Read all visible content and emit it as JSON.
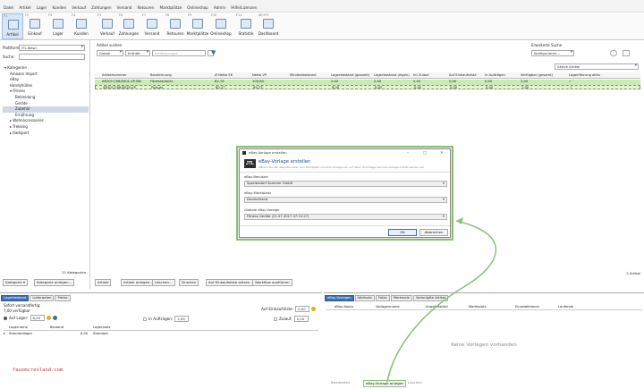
{
  "menu": [
    "Datei",
    "Artikel",
    "Lager",
    "Kunden",
    "Verkauf",
    "Zahlungen",
    "Versand",
    "Retouren",
    "Marktplätze",
    "Onlineshop",
    "Admin",
    "Hilfe/Lizenzen"
  ],
  "toolbar": [
    {
      "key": "F1",
      "label": "Artikel",
      "active": true
    },
    {
      "key": "F2",
      "label": "Einkauf"
    },
    {
      "key": "F3",
      "label": "Lager"
    },
    {
      "key": "F4",
      "label": "Kunden"
    },
    {
      "key": "F5",
      "label": "Verkauf"
    },
    {
      "key": "F6",
      "label": "Zahlungen"
    },
    {
      "key": "F7",
      "label": "Versand"
    },
    {
      "key": "F8",
      "label": "Retouren"
    },
    {
      "key": "F9",
      "label": "Marktplätze"
    },
    {
      "key": "F10",
      "label": "Onlineshop"
    },
    {
      "key": "F11",
      "label": "Statistik"
    },
    {
      "key": "Alt+F2",
      "label": "Dashboard"
    }
  ],
  "sidebar": {
    "plattform_label": "Plattform:",
    "plattform_value": "JTL-Wawi",
    "suche_label": "Suche:",
    "tree": [
      {
        "label": "Kategorien",
        "level": 0
      },
      {
        "label": "Amazon Import",
        "level": 1
      },
      {
        "label": "eBay",
        "level": 1
      },
      {
        "label": "Handyhüllen",
        "level": 1
      },
      {
        "label": "Fitness",
        "level": 1
      },
      {
        "label": "Bekleidung",
        "level": 2
      },
      {
        "label": "Geräte",
        "level": 2
      },
      {
        "label": "Zubehör",
        "level": 2,
        "selected": true
      },
      {
        "label": "Ernährung",
        "level": 2
      },
      {
        "label": "Wohnaccessoires",
        "level": 1
      },
      {
        "label": "Trekking",
        "level": 1
      },
      {
        "label": "Radsport",
        "level": 1
      }
    ],
    "count": "21 Kategorien",
    "btn_kategorie": "Kategorie",
    "btn_kategorie_anlegen": "Kategorie anlegen..."
  },
  "main": {
    "search_label": "Artikel suchen",
    "filter1": "Global",
    "filter2": "Enthält",
    "filter3": "Artikelgruppe",
    "extended_label": "Erweiterte Suche",
    "extended_value": "Konfigurieren...",
    "active_label": "Aktive Artikel",
    "columns": [
      "Artikelnummer",
      "Bezeichnung",
      "Ø Netto EK",
      "Netto VP",
      "Mindestbestand",
      "Lagerbestand (gesamt)",
      "Lagerbestand (eigen)",
      "Im Zulauf",
      "Auf Einkaufsliste",
      "In Aufträgen",
      "Verfügbar (gesamt)",
      "Lagerführung aktiv"
    ],
    "rows": [
      [
        "AR2017/06/0001-VP-NN",
        "Fitnesstrainer",
        "82,78",
        "100,84",
        "",
        "2,00",
        "2,00",
        "0,00",
        "0,00",
        "0,00",
        "2,00",
        "✓"
      ],
      [
        "AR2017/06/0025-VP",
        "Pulsuhr",
        "60,17",
        "99,23",
        "",
        "8,00",
        "8,00",
        "0,00",
        "0,00",
        "0,00",
        "7,00",
        "✓"
      ]
    ],
    "footer_count": "2 Artikel",
    "footer_buttons": [
      "Artikel",
      "Artikel anlegen...",
      "Löschen...",
      "Drucken",
      "Auf Einkaufsliste setzen...",
      "Workflow ausführen"
    ]
  },
  "bottom_left": {
    "tabs": [
      "Lagerbestand",
      "Lieferanten",
      "Preise"
    ],
    "line1": "Sofort versandfertig:",
    "line2": "7,00 verfügbar",
    "auf_lager_label": "Auf Lager:",
    "auf_lager_value": "8,00",
    "einkaufsliste_label": "Auf Einkaufsliste:",
    "einkaufsliste_value": "0,00",
    "auftraegen_label": "In Aufträgen:",
    "auftraegen_value": "2,00",
    "zulauf_label": "Zulauf:",
    "zulauf_value": "0,00",
    "cols": [
      "Lagername",
      "Bestand",
      "Lagerplatz"
    ],
    "row": [
      "Standardlager",
      "8,00",
      "Standard"
    ],
    "watermark": "fauxmcreoland.com"
  },
  "bottom_right": {
    "tabs": [
      "eBay-Vorlagen",
      "Attribute",
      "Fotos",
      "Merkmale",
      "Verknüpfte Artikel"
    ],
    "cols": [
      "eBay-Konto",
      "Vorlagenname",
      "Angebotstitel",
      "Marktplatz",
      "Einzelaktionen",
      "Laufende"
    ],
    "empty": "Keine Vorlagen vorhanden",
    "btn_bearbeiten": "Bearbeiten",
    "btn_erstellen": "eBay-Vorlage anlegen",
    "btn_loeschen": "Löschen"
  },
  "dialog": {
    "title": "eBay-Vorlage erstellen",
    "heading": "eBay-Vorlage erstellen",
    "subtext": "Wählen Sie den eBay-Benutzer, den Marktplatz und eine Vorlage aus, auf deren Grundlage die neue Vorlage erstellt werden soll.",
    "user_label": "eBay-Benutzer",
    "user_value": "Sportbedarf Sommer GmbH",
    "market_label": "eBay-Marktplatz",
    "market_value": "Deutschland",
    "template_label": "Globale eBay-Vorlage",
    "template_value": "Fitness Geräte (21.07.2017 07:15:27)",
    "ok": "OK",
    "cancel": "Abbrechen"
  },
  "colors": {
    "highlight": "#8cc37a",
    "accent": "#3d6fb0",
    "row_select": "#c8ecb2"
  }
}
